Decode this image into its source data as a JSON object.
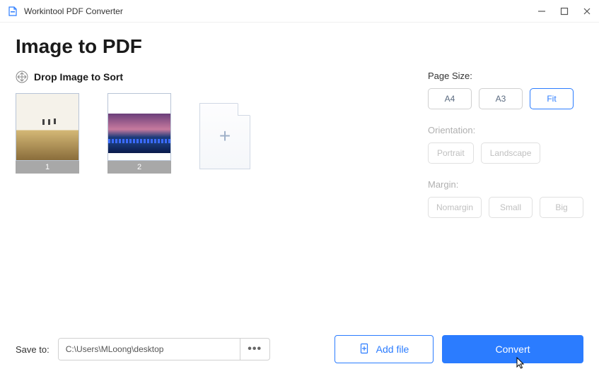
{
  "app": {
    "title": "Workintool PDF Converter"
  },
  "page": {
    "title": "Image to PDF"
  },
  "sort": {
    "label": "Drop Image to Sort"
  },
  "thumbs": [
    {
      "index": "1"
    },
    {
      "index": "2"
    }
  ],
  "options": {
    "pageSize": {
      "label": "Page Size:",
      "items": {
        "a4": "A4",
        "a3": "A3",
        "fit": "Fit"
      },
      "selected": "fit"
    },
    "orientation": {
      "label": "Orientation:",
      "items": {
        "portrait": "Portrait",
        "landscape": "Landscape"
      },
      "disabled": true
    },
    "margin": {
      "label": "Margin:",
      "items": {
        "nomargin": "Nomargin",
        "small": "Small",
        "big": "Big"
      },
      "disabled": true
    }
  },
  "footer": {
    "saveLabel": "Save to:",
    "path": "C:\\Users\\MLoong\\desktop",
    "more": "•••",
    "addFile": "Add file",
    "convert": "Convert"
  }
}
